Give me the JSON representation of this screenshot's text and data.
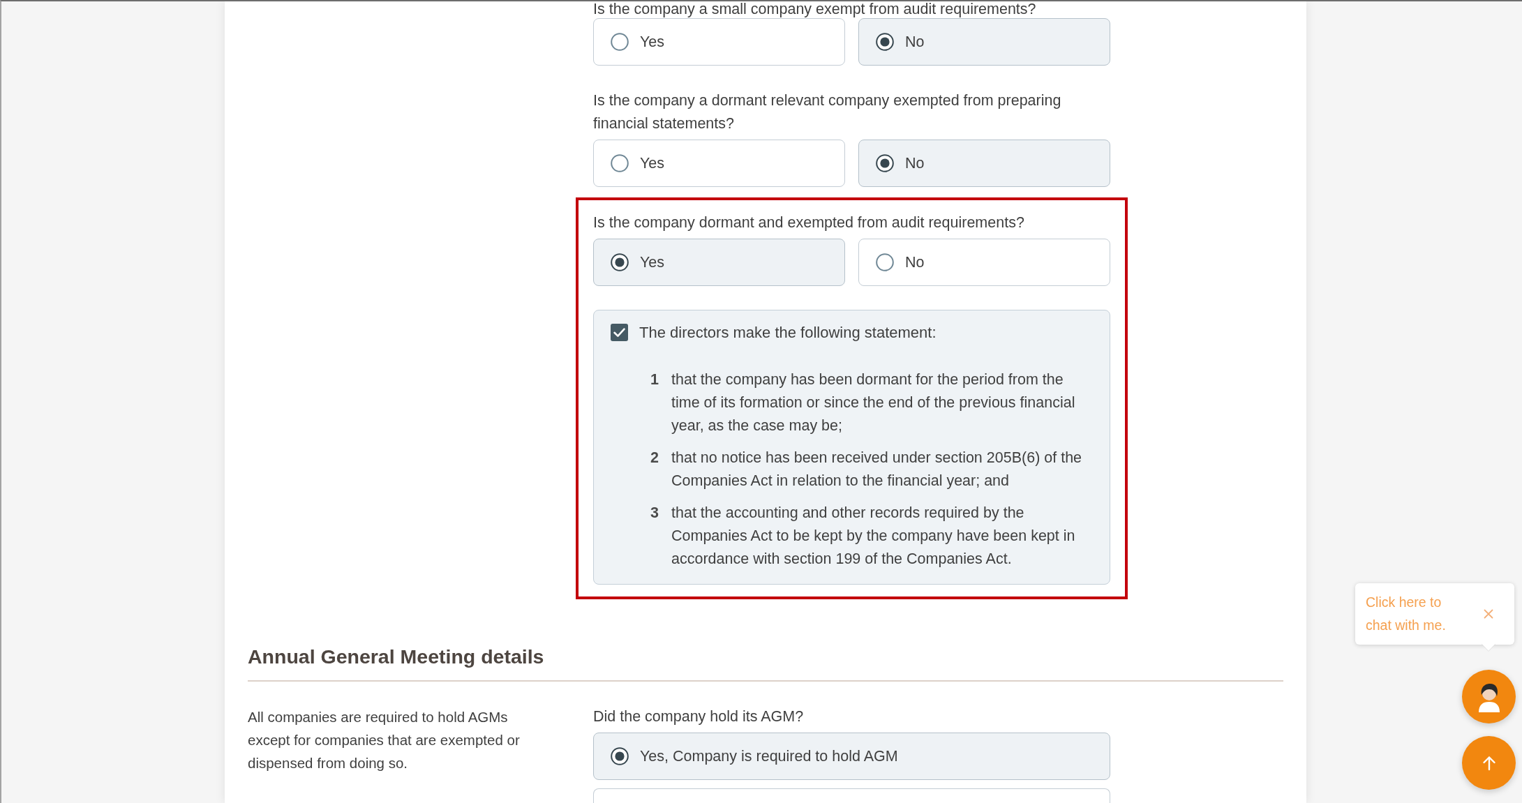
{
  "questions": [
    {
      "text": "Is the company a small company exempt from audit requirements?",
      "highlighted": false,
      "options": [
        {
          "label": "Yes",
          "selected": false
        },
        {
          "label": "No",
          "selected": true
        }
      ]
    },
    {
      "text": "Is the company a dormant relevant company exempted from preparing financial statements?",
      "highlighted": false,
      "options": [
        {
          "label": "Yes",
          "selected": false
        },
        {
          "label": "No",
          "selected": true
        }
      ]
    },
    {
      "text": "Is the company dormant and exempted from audit requirements?",
      "highlighted": true,
      "options": [
        {
          "label": "Yes",
          "selected": true
        },
        {
          "label": "No",
          "selected": false
        }
      ],
      "statement": {
        "label": "The directors make the following statement:",
        "checked": true,
        "items": [
          {
            "number": "1",
            "text": "that the company has been dormant for the period from the time of its formation or since the end of the previous financial year, as the case may be;"
          },
          {
            "number": "2",
            "text": "that no notice has been received under section 205B(6) of the Companies Act in relation to the financial year; and"
          },
          {
            "number": "3",
            "text": "that the accounting and other records required by the Companies Act to be kept by the company have been kept in accordance with section 199 of the Companies Act."
          }
        ]
      }
    }
  ],
  "agm_section": {
    "title": "Annual General Meeting details",
    "description": "All companies are required to hold AGMs except for companies that are exempted or dispensed from doing so.",
    "question": {
      "text": "Did the company hold its AGM?",
      "options": [
        {
          "label": "Yes, Company is required to hold AGM",
          "selected": true
        },
        {
          "selected": false
        }
      ]
    }
  },
  "chat_tooltip": {
    "text": "Click here to chat with me."
  }
}
